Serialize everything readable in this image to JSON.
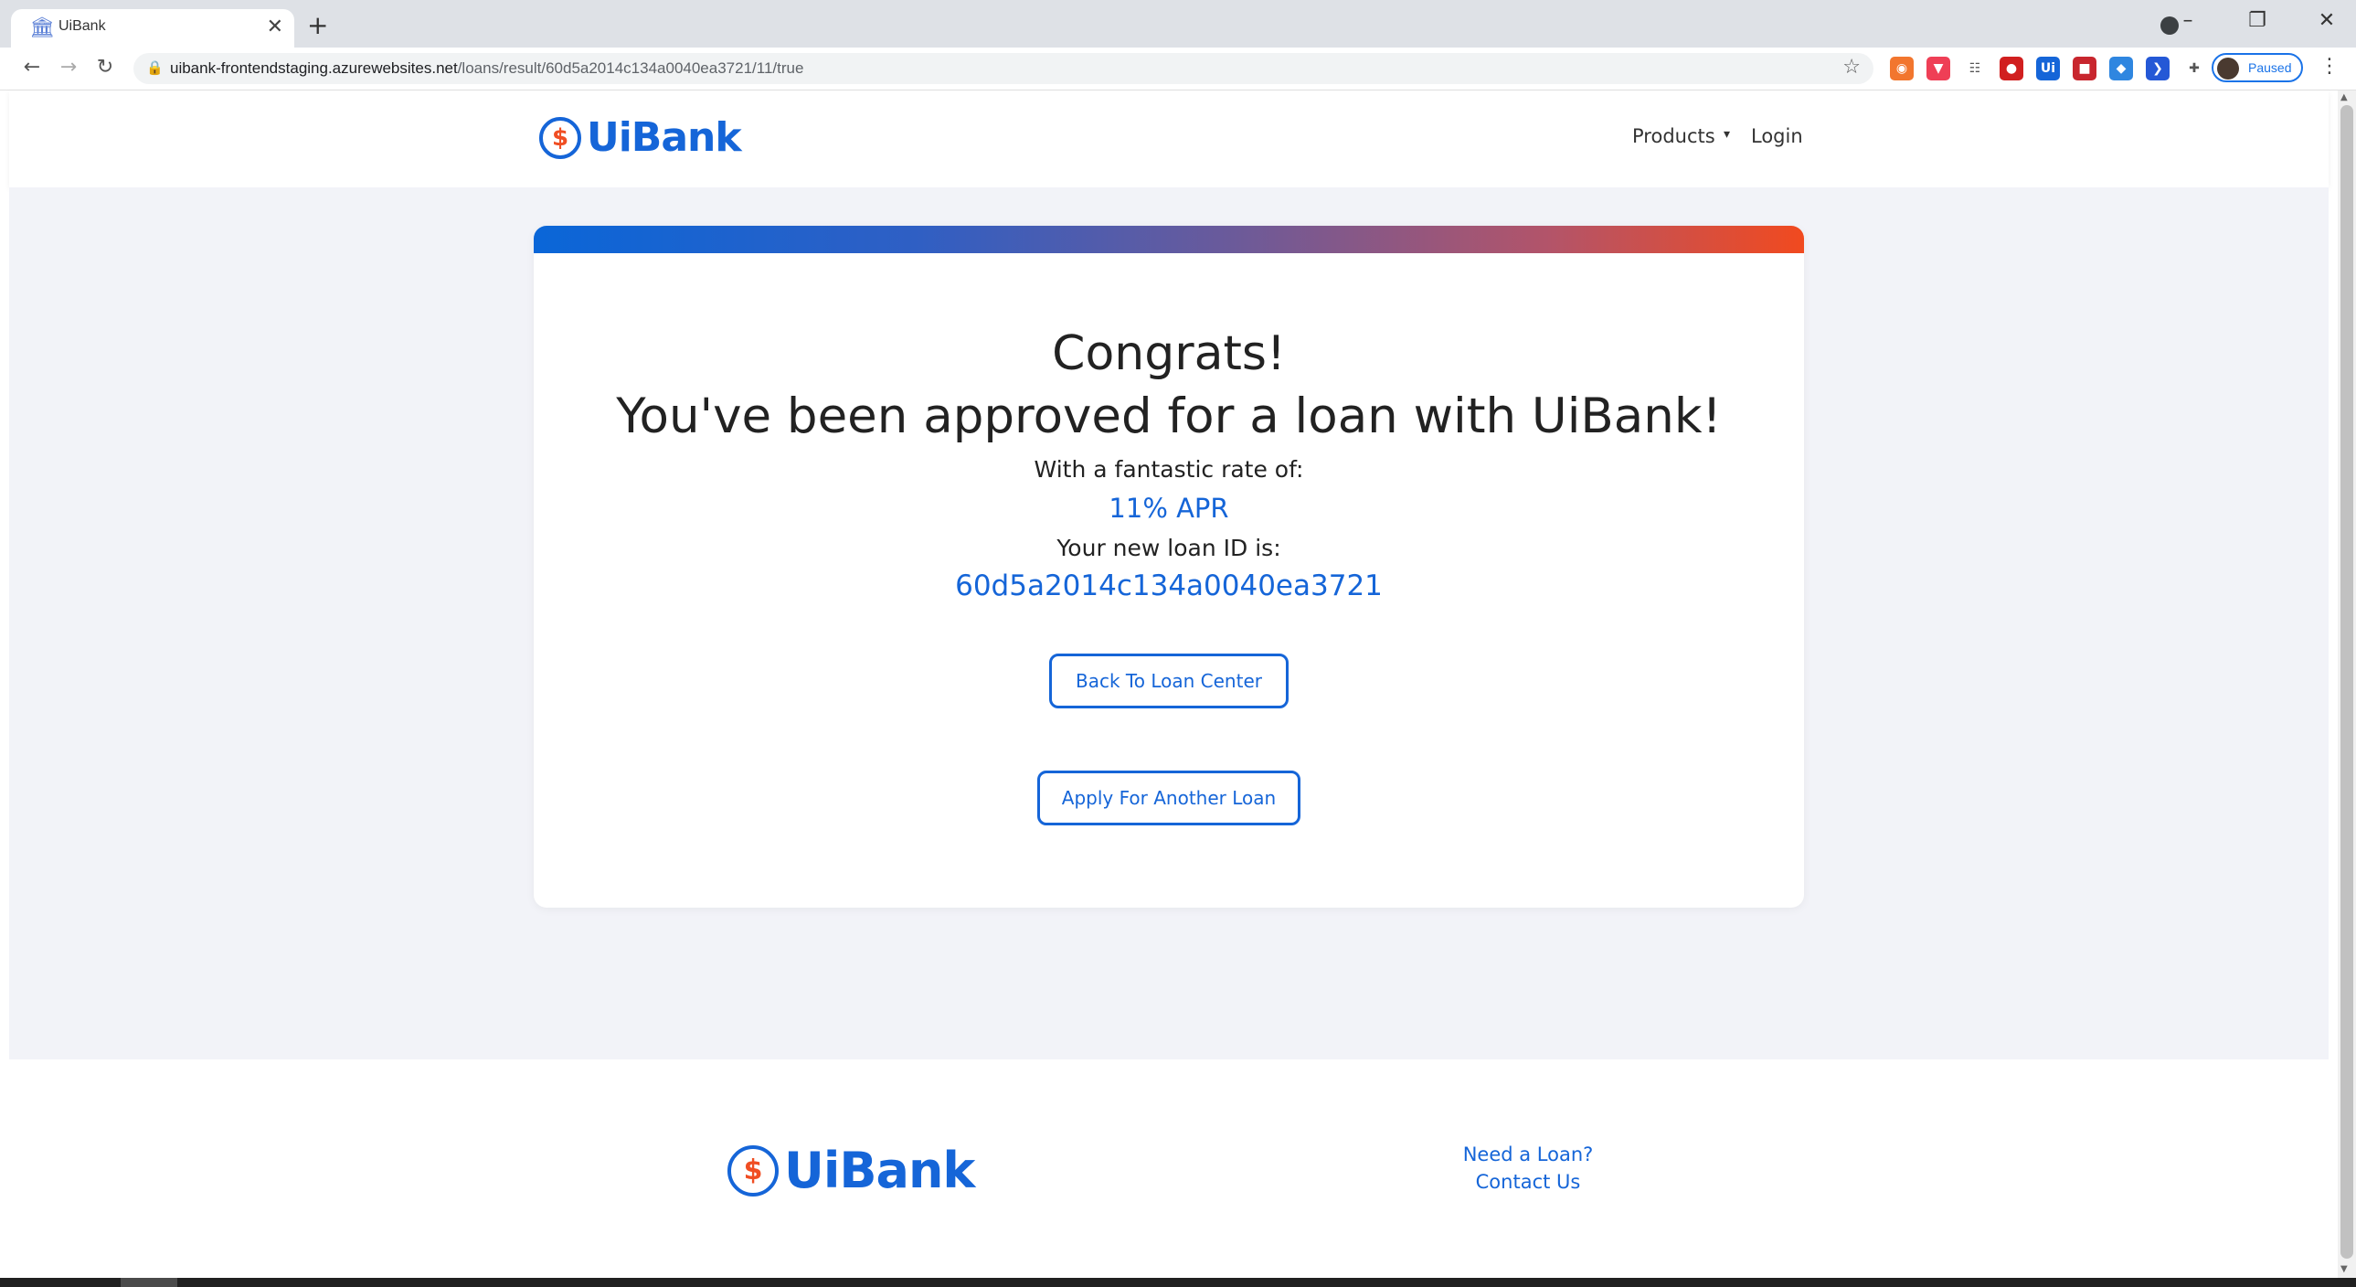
{
  "browser": {
    "tab_title": "UiBank",
    "tab_close": "✕",
    "new_tab": "+",
    "url_host": "uibank-frontendstaging.azurewebsites.net",
    "url_path": "/loans/result/60d5a2014c134a0040ea3721/11/true",
    "profile_status": "Paused",
    "window_controls": [
      "–",
      "❐",
      "✕"
    ],
    "extensions": [
      {
        "icon": "circle-ext-icon",
        "color": "#f2762e",
        "glyph": "◉"
      },
      {
        "icon": "pocket-ext-icon",
        "color": "#ef3f56",
        "glyph": "▼"
      },
      {
        "icon": "grid-ext-icon",
        "color": "#ffffff",
        "glyph": "☷"
      },
      {
        "icon": "shield-ext-icon",
        "color": "#d11f1f",
        "glyph": "●"
      },
      {
        "icon": "ui-ext-icon",
        "color": "#1565d8",
        "glyph": "Ui"
      },
      {
        "icon": "red-square-ext-icon",
        "color": "#c8262e",
        "glyph": "■"
      },
      {
        "icon": "drop-ext-icon",
        "color": "#2f86e0",
        "glyph": "◆"
      },
      {
        "icon": "arrow-ext-icon",
        "color": "#2458d6",
        "glyph": "❯"
      },
      {
        "icon": "puzzle-ext-icon",
        "color": "#ffffff",
        "glyph": "✚"
      }
    ]
  },
  "nav": {
    "logo_text": "UiBank",
    "logo_symbol": "$",
    "products_label": "Products",
    "products_caret": "▾",
    "login_label": "Login"
  },
  "result": {
    "heading": "Congrats!",
    "subheading": "You've been approved for a loan with UiBank!",
    "rate_label": "With a fantastic rate of:",
    "rate_value": "11% APR",
    "loan_id_label": "Your new loan ID is:",
    "loan_id_value": "60d5a2014c134a0040ea3721",
    "back_button": "Back To Loan Center",
    "apply_button": "Apply For Another Loan"
  },
  "footer": {
    "logo_text": "UiBank",
    "logo_symbol": "$",
    "need_loan": "Need a Loan?",
    "contact_us": "Contact Us"
  },
  "colors": {
    "brand_blue": "#1565d8",
    "brand_orange": "#f04e23",
    "page_background": "#f2f3f8"
  }
}
